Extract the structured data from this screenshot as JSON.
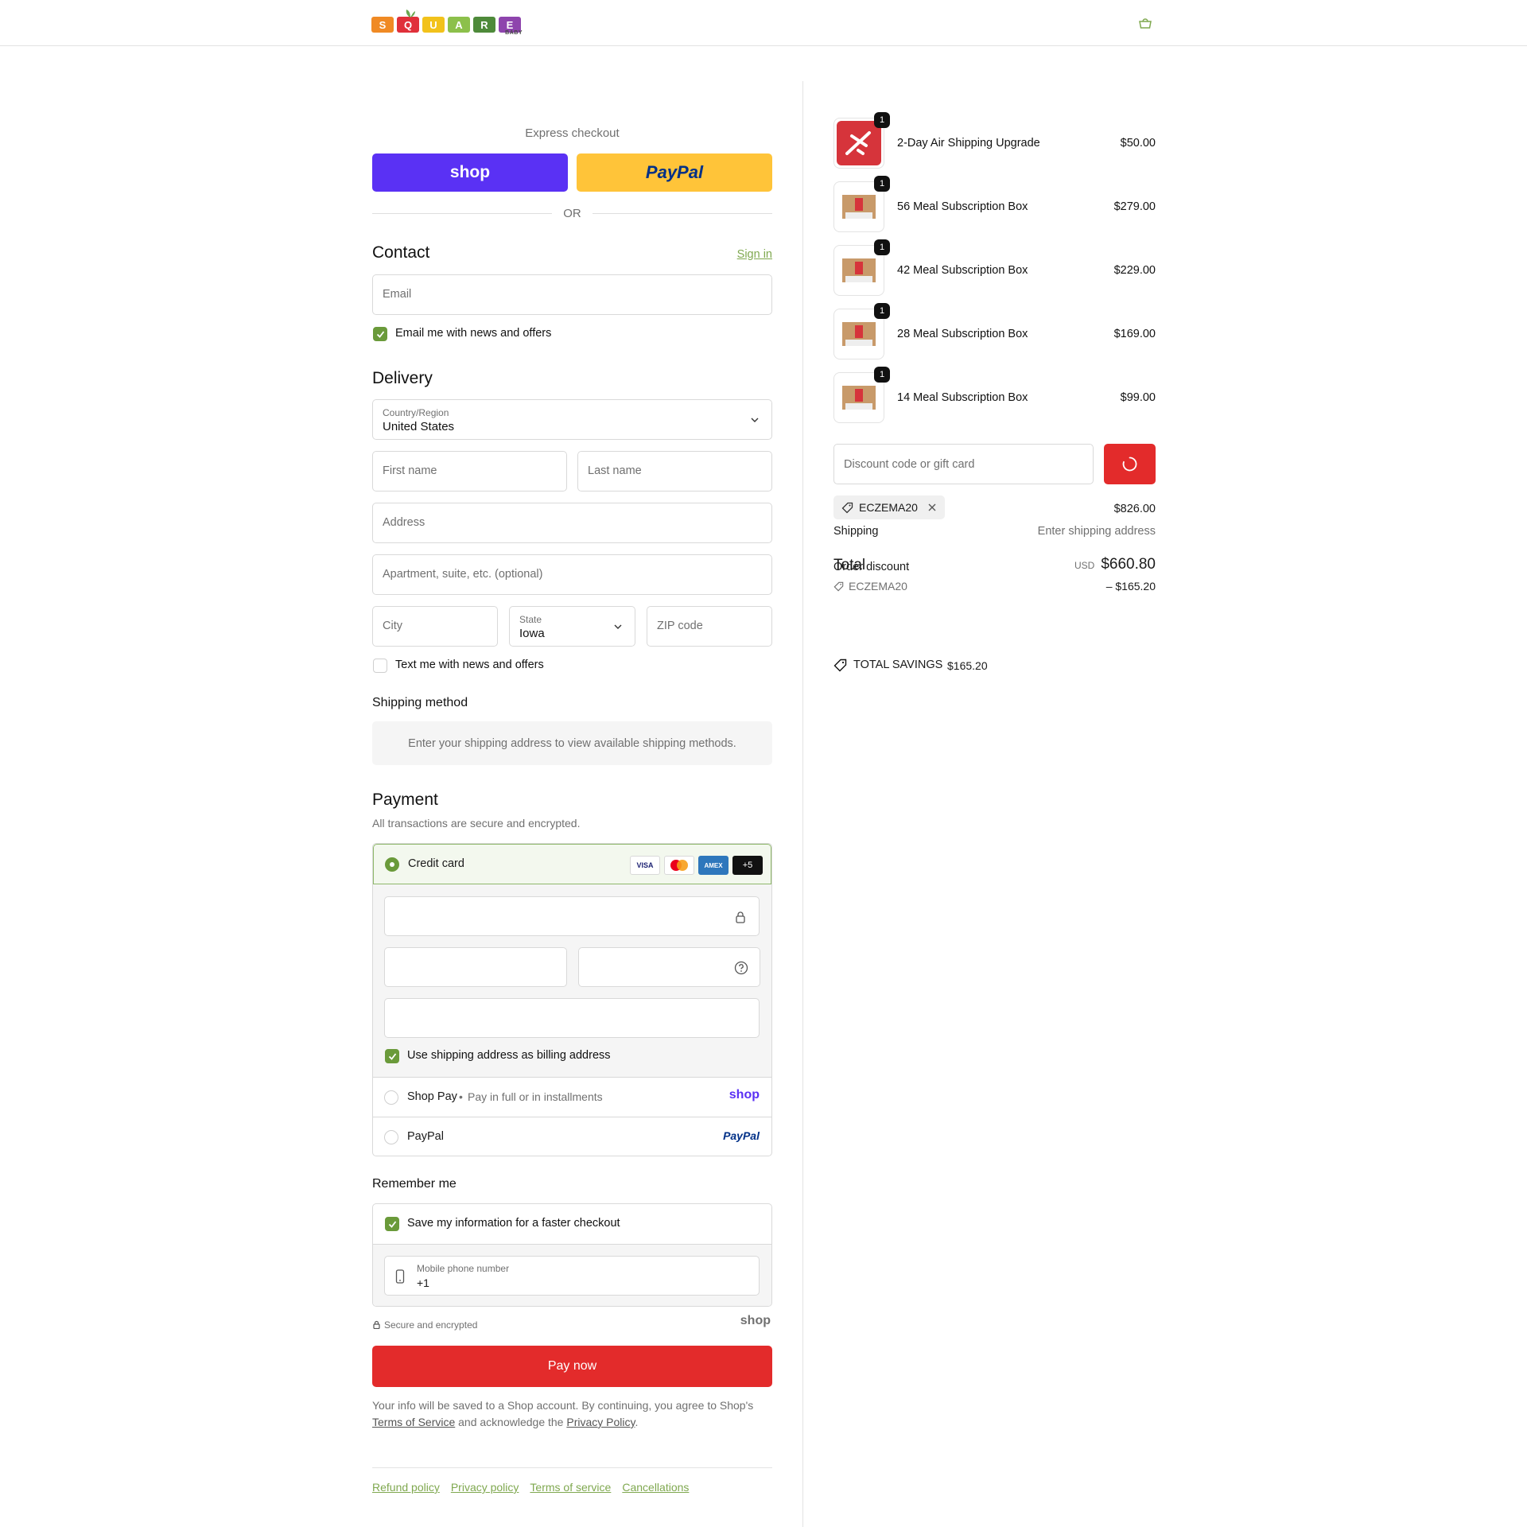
{
  "brand": {
    "logo_letters": [
      "S",
      "Q",
      "U",
      "A",
      "R",
      "E"
    ],
    "logo_colors": [
      "#f08a24",
      "#e0303a",
      "#f2c21b",
      "#8cc04b",
      "#4e8a3a",
      "#8e44ad"
    ],
    "logo_sub": "BABY",
    "accent": "#6a9a3a",
    "pay_button_color": "#e32b2b"
  },
  "express": {
    "label": "Express checkout",
    "shop_label": "shop",
    "paypal_label": "PayPal",
    "or": "OR"
  },
  "contact": {
    "title": "Contact",
    "sign_in": "Sign in",
    "email_placeholder": "Email",
    "news_label": "Email me with news and offers"
  },
  "delivery": {
    "title": "Delivery",
    "country_label": "Country/Region",
    "country_value": "United States",
    "first_name": "First name",
    "last_name": "Last name",
    "address": "Address",
    "apartment": "Apartment, suite, etc. (optional)",
    "city": "City",
    "state_label": "State",
    "state_value": "Iowa",
    "zip": "ZIP code",
    "text_offers": "Text me with news and offers"
  },
  "shipping_method": {
    "title": "Shipping method",
    "notice": "Enter your shipping address to view available shipping methods."
  },
  "payment": {
    "title": "Payment",
    "subtitle": "All transactions are secure and encrypted.",
    "credit_card": "Credit card",
    "card_brands": [
      "VISA",
      "",
      "AMEX",
      "+5"
    ],
    "billing_same": "Use shipping address as billing address",
    "shop_pay": "Shop Pay",
    "shop_pay_sub": "Pay in full or in installments",
    "shop_pay_logo": "shop",
    "paypal": "PayPal",
    "paypal_logo": "PayPal"
  },
  "remember": {
    "title": "Remember me",
    "save_label": "Save my information for a faster checkout",
    "phone_label": "Mobile phone number",
    "phone_value": "+1",
    "secure": "Secure and encrypted",
    "shop_logo": "shop"
  },
  "pay_now": "Pay now",
  "legal": {
    "text1": "Your info will be saved to a Shop account. By continuing, you agree to Shop's",
    "terms": "Terms of Service",
    "text2": "and acknowledge the",
    "privacy": "Privacy Policy",
    "text3": "."
  },
  "footer": [
    "Refund policy",
    "Privacy policy",
    "Terms of service",
    "Cancellations"
  ],
  "cart": {
    "items": [
      {
        "qty": "1",
        "name": "2-Day Air Shipping Upgrade",
        "price": "$50.00"
      },
      {
        "qty": "1",
        "name": "56 Meal Subscription Box",
        "price": "$279.00"
      },
      {
        "qty": "1",
        "name": "42 Meal Subscription Box",
        "price": "$229.00"
      },
      {
        "qty": "1",
        "name": "28 Meal Subscription Box",
        "price": "$169.00"
      },
      {
        "qty": "1",
        "name": "14 Meal Subscription Box",
        "price": "$99.00"
      }
    ],
    "discount_placeholder": "Discount code or gift card",
    "applied_code": "ECZEMA20",
    "subtotal_value": "$826.00",
    "shipping_label": "Shipping",
    "shipping_value": "Enter shipping address",
    "order_discount_label": "Order discount",
    "discount_code": "ECZEMA20",
    "discount_value": "– $165.20",
    "total_label": "Total",
    "currency": "USD",
    "total_value": "$660.80",
    "savings_label": "TOTAL SAVINGS",
    "savings_value": "$165.20"
  }
}
